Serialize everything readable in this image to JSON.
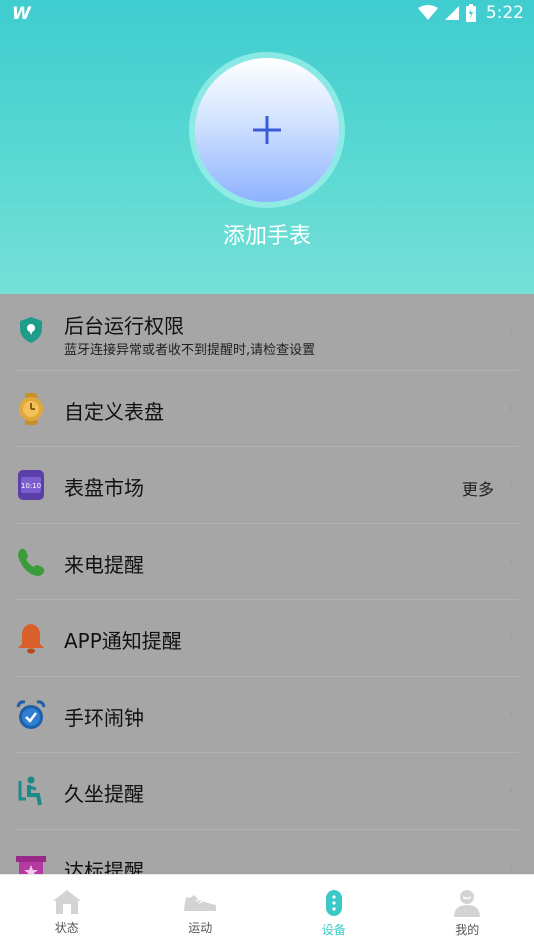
{
  "status_bar": {
    "logo": "W",
    "time": "5:22",
    "icons": [
      "wifi-icon",
      "signal-icon",
      "battery-icon"
    ]
  },
  "header": {
    "add_button_icon": "plus-icon",
    "add_title": "添加手表"
  },
  "settings": [
    {
      "icon": "shield-location-icon",
      "title": "后台运行权限",
      "subtitle": "蓝牙连接异常或者收不到提醒时,请检查设置"
    },
    {
      "icon": "watch-face-icon",
      "title": "自定义表盘"
    },
    {
      "icon": "dial-market-icon",
      "title": "表盘市场",
      "more": "更多"
    },
    {
      "icon": "phone-icon",
      "title": "来电提醒"
    },
    {
      "icon": "bell-icon",
      "title": "APP通知提醒"
    },
    {
      "icon": "alarm-clock-icon",
      "title": "手环闹钟"
    },
    {
      "icon": "sitting-icon",
      "title": "久坐提醒"
    },
    {
      "icon": "goal-box-icon",
      "title": "达标提醒"
    }
  ],
  "tabs": [
    {
      "label": "状态",
      "icon": "home-icon",
      "active": false
    },
    {
      "label": "运动",
      "icon": "shoe-icon",
      "active": false
    },
    {
      "label": "设备",
      "icon": "band-icon",
      "active": true
    },
    {
      "label": "我的",
      "icon": "person-icon",
      "active": false
    }
  ],
  "colors": {
    "header_teal": "#3fcdd0",
    "active_tab": "#3cc8c6",
    "overlay_gray": "#a6a6a6",
    "plus_blue": "#3b5bdb"
  }
}
